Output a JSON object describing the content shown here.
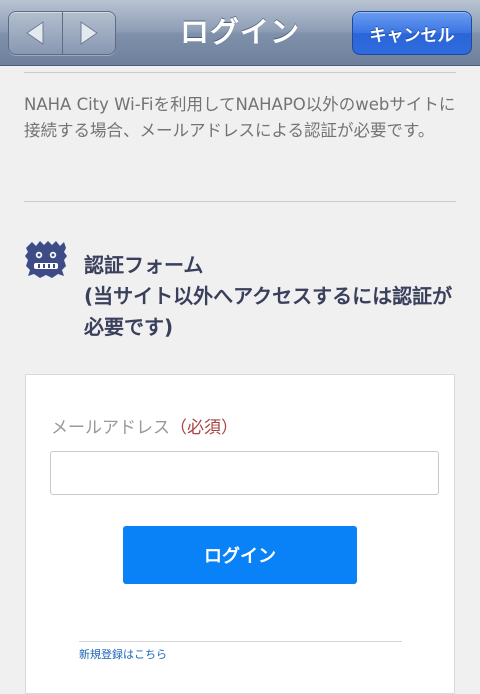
{
  "navbar": {
    "title": "ログイン",
    "cancel_label": "キャンセル",
    "back_icon": "chevron-left-icon",
    "forward_icon": "chevron-right-icon"
  },
  "intro": {
    "text": "NAHA City Wi-Fiを利用してNAHAPO以外のwebサイトに接続する場合、メールアドレスによる認証が必要です。"
  },
  "form": {
    "icon": "shisa-logo-icon",
    "title": "認証フォーム",
    "subtitle": "(当サイト以外へアクセスするには認証が必要です)",
    "email_label": "メールアドレス",
    "required_mark": "（必須）",
    "email_value": "",
    "login_label": "ログイン",
    "register_link": "新規登録はこちら"
  },
  "colors": {
    "primary_button": "#0a82f7",
    "title_text": "#3a3f5c",
    "required": "#a94442",
    "link": "#1d66b8"
  }
}
